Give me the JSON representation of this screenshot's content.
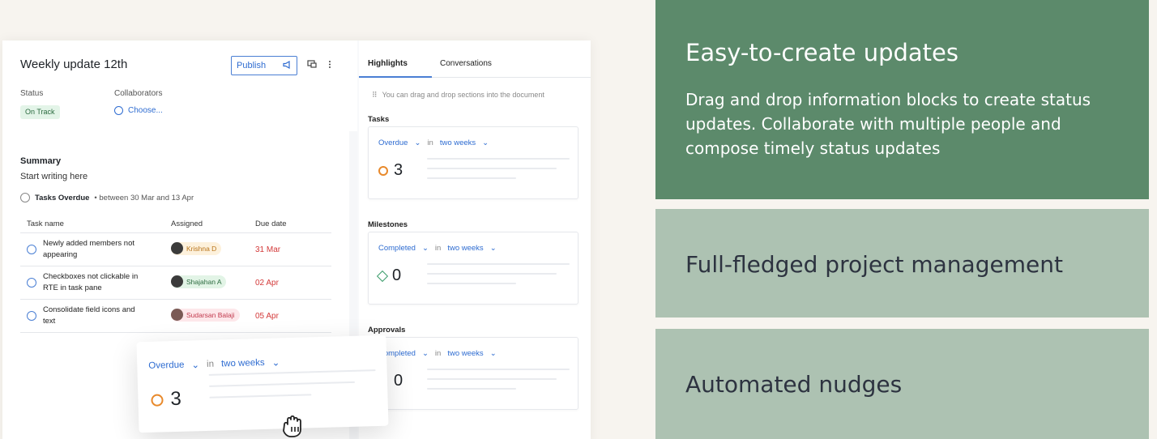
{
  "doc": {
    "title": "Weekly update 12th",
    "publish_label": "Publish",
    "status_label": "Status",
    "status_value": "On Track",
    "collaborators_label": "Collaborators",
    "collaborators_value": "Choose...",
    "summary_title": "Summary",
    "summary_text": "Start writing here",
    "overdue_title": "Tasks Overdue",
    "overdue_range": "• between 30 Mar and 13 Apr",
    "table": {
      "headers": [
        "Task name",
        "Assigned",
        "Due date"
      ],
      "rows": [
        {
          "task": "Newly added members not appearing",
          "assignee": "Krishna D",
          "assignee_bg": "#fdf1dc",
          "assignee_color": "#b8741a",
          "due": "31 Mar"
        },
        {
          "task": "Checkboxes not clickable in RTE in task pane",
          "assignee": "Shajahan A",
          "assignee_bg": "#e2f4e6",
          "assignee_color": "#2b6a3f",
          "due": "02 Apr"
        },
        {
          "task": "Consolidate field icons and text",
          "assignee": "Sudarsan Balaji",
          "assignee_bg": "#fde7ea",
          "assignee_color": "#c23a4e",
          "due": "05 Apr"
        }
      ]
    }
  },
  "pane": {
    "tab_active": "Highlights",
    "tab_other": "Conversations",
    "drag_hint": "You can drag and drop sections into the document",
    "sections": [
      {
        "label": "Tasks",
        "filter": "Overdue",
        "in": "in",
        "period": "two weeks",
        "value": "3",
        "icon": "ring-icon"
      },
      {
        "label": "Milestones",
        "filter": "Completed",
        "in": "in",
        "period": "two weeks",
        "value": "0",
        "icon": "diamond-icon"
      },
      {
        "label": "Approvals",
        "filter": "Completed",
        "in": "in",
        "period": "two weeks",
        "value": "0",
        "icon": "none"
      }
    ]
  },
  "floating": {
    "filter": "Overdue",
    "in": "in",
    "period": "two weeks",
    "value": "3"
  },
  "features": [
    {
      "title": "Easy-to-create updates",
      "text": "Drag and drop information blocks to create status updates. Collaborate with multiple people and compose timely status updates"
    },
    {
      "title": "Full-fledged project management"
    },
    {
      "title": "Automated nudges"
    }
  ],
  "colors": {
    "accent": "#2e6cd1",
    "feature_active": "#5c8a6b",
    "feature_inactive": "#adc2b2",
    "overdue": "#d33a3a"
  }
}
